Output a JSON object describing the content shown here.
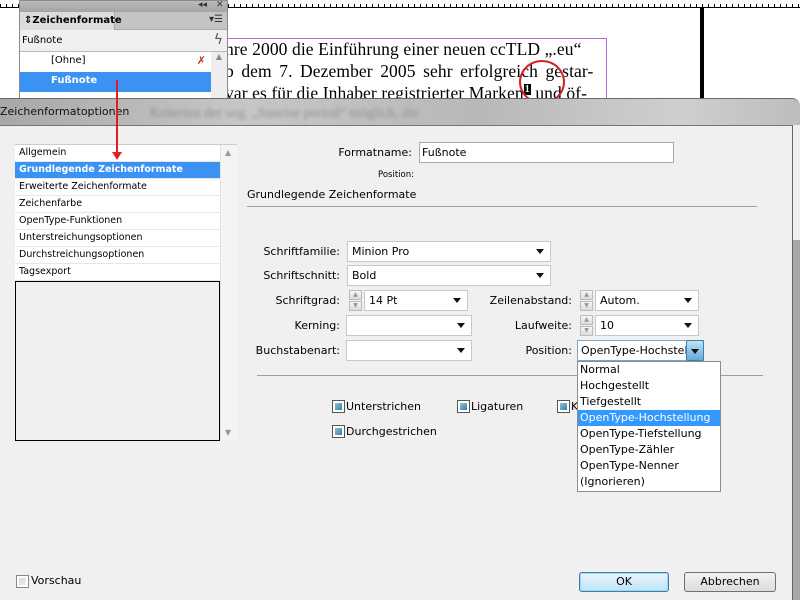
{
  "document": {
    "lines": [
      "hre 2000 die Einführung einer neuen ccTLD „.eu“",
      "b dem 7. Dezember 2005 sehr erfolgreich gestar-",
      "var es für die Inhaber registrierter Marken"
    ],
    "line3_tail": " und öf-",
    "footnote_marker": "1",
    "blurred_line": "Kriterien der sog. „Sunrise period“ möglich, die"
  },
  "panel": {
    "title": "Zeichenformate",
    "menu_icon": "panel-menu-icon",
    "collapse_icon": "◂◂",
    "close_icon": "✕",
    "current_style": "Fußnote",
    "items": [
      {
        "label": "[Ohne]",
        "selected": false
      },
      {
        "label": "Fußnote",
        "selected": true
      }
    ]
  },
  "dialog": {
    "title": "Zeichenformatoptionen",
    "categories": [
      {
        "label": "Allgemein",
        "selected": false
      },
      {
        "label": "Grundlegende Zeichenformate",
        "selected": true
      },
      {
        "label": "Erweiterte Zeichenformate",
        "selected": false
      },
      {
        "label": "Zeichenfarbe",
        "selected": false
      },
      {
        "label": "OpenType-Funktionen",
        "selected": false
      },
      {
        "label": "Unterstreichungsoptionen",
        "selected": false
      },
      {
        "label": "Durchstreichungsoptionen",
        "selected": false
      },
      {
        "label": "Tagsexport",
        "selected": false
      }
    ],
    "format_name_label": "Formatname:",
    "format_name_value": "Fußnote",
    "position_label_small": "Position:",
    "section_title": "Grundlegende Zeichenformate",
    "fields": {
      "font_family": {
        "label": "Schriftfamilie:",
        "value": "Minion Pro"
      },
      "font_style": {
        "label": "Schriftschnitt:",
        "value": "Bold"
      },
      "font_size": {
        "label": "Schriftgrad:",
        "value": "14 Pt"
      },
      "leading": {
        "label": "Zeilenabstand:",
        "value": "Autom."
      },
      "kerning": {
        "label": "Kerning:",
        "value": ""
      },
      "tracking": {
        "label": "Laufweite:",
        "value": "10"
      },
      "case": {
        "label": "Buchstabenart:",
        "value": ""
      },
      "position": {
        "label": "Position:",
        "value": "OpenType-Hochstellung"
      }
    },
    "position_options": [
      {
        "label": "Normal",
        "selected": false
      },
      {
        "label": "Hochgestellt",
        "selected": false
      },
      {
        "label": "Tiefgestellt",
        "selected": false
      },
      {
        "label": "OpenType-Hochstellung",
        "selected": true
      },
      {
        "label": "OpenType-Tiefstellung",
        "selected": false
      },
      {
        "label": "OpenType-Zähler",
        "selected": false
      },
      {
        "label": "OpenType-Nenner",
        "selected": false
      },
      {
        "label": "(Ignorieren)",
        "selected": false
      }
    ],
    "checkboxes": {
      "underline": {
        "label": "Unterstrichen",
        "state": "indeterminate"
      },
      "ligatures": {
        "label": "Ligaturen",
        "state": "indeterminate"
      },
      "caps": {
        "label": "K",
        "state": "indeterminate"
      },
      "strikethrough": {
        "label": "Durchgestrichen",
        "state": "indeterminate"
      }
    },
    "preview": {
      "label": "Vorschau",
      "checked": false
    },
    "ok_label": "OK",
    "cancel_label": "Abbrechen"
  },
  "colors": {
    "selection": "#3a92f2",
    "annotation_red": "#e02020",
    "frame_purple": "#b46ad0"
  }
}
